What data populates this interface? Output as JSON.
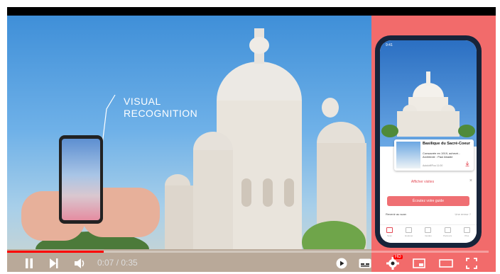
{
  "video": {
    "caption_lines": [
      "VISUAL",
      "RECOGNITION"
    ],
    "colors": {
      "panel": "#f26b6b",
      "accent": "#ff0000"
    }
  },
  "app_screen": {
    "status_time": "9:41",
    "card": {
      "title": "Basilique du Sacré-Coeur",
      "description": "Consacrée en 1919, achevé... Architecte : Paul Abadie",
      "meta": "Autoloff/Fou 11:00",
      "download_icon": "download-icon"
    },
    "sheet": {
      "title": "Afficher visites",
      "button_label": "Écoutez votre guide",
      "back_label": "Revenir au scan",
      "help_label": "Une erreur ?"
    },
    "tabs": [
      {
        "label": "Scan",
        "icon": "scan-icon"
      },
      {
        "label": "Explorer",
        "icon": "map-icon"
      },
      {
        "label": "Guides",
        "icon": "headphones-icon"
      },
      {
        "label": "Parcours",
        "icon": "route-icon"
      },
      {
        "label": "Plus",
        "icon": "grid-icon"
      }
    ]
  },
  "player": {
    "time_display": "0:07 / 0:35",
    "progress": 0.2,
    "quality_badge": "HD"
  }
}
